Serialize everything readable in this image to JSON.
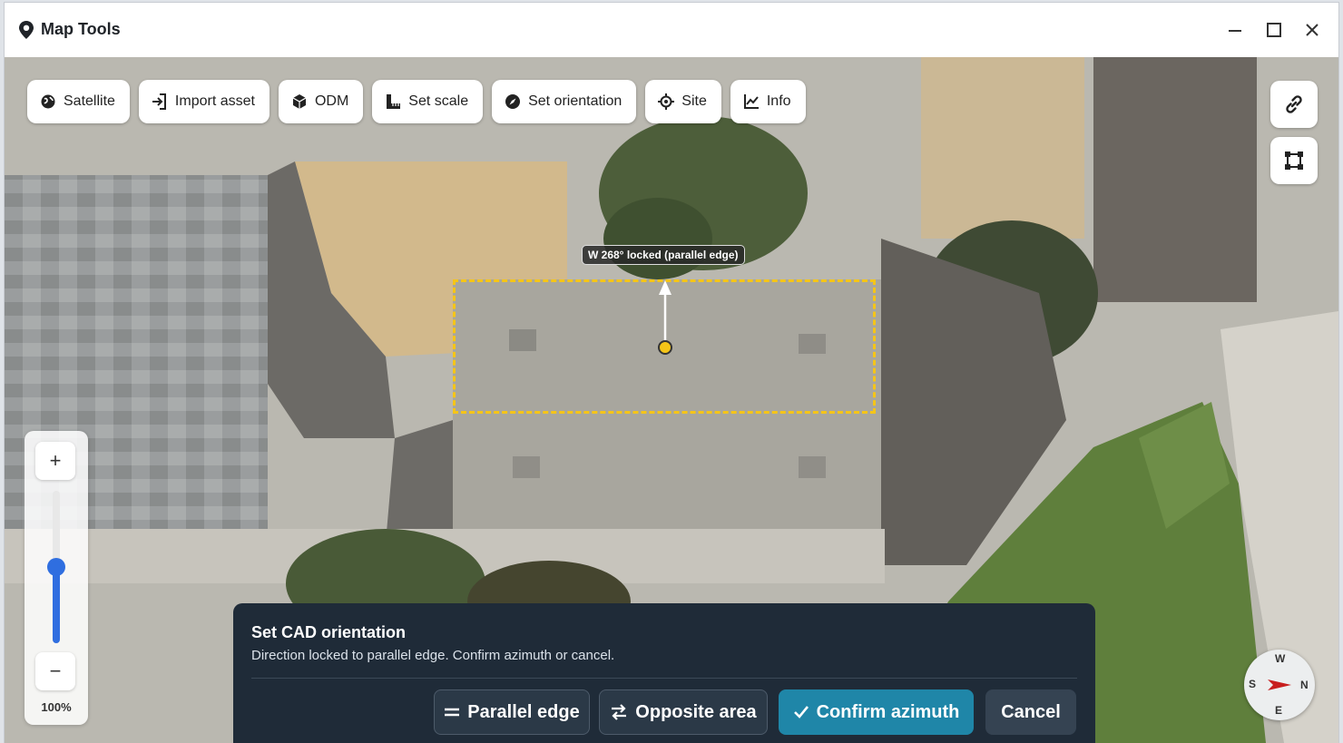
{
  "window": {
    "title": "Map Tools",
    "pin_icon": "map-pin-icon",
    "controls": [
      "minimize-icon",
      "maximize-icon",
      "close-icon"
    ]
  },
  "toolbar": {
    "buttons": [
      {
        "label": "Satellite",
        "icon": "globe-icon"
      },
      {
        "label": "Import asset",
        "icon": "import-icon"
      },
      {
        "label": "ODM",
        "icon": "cube-icon"
      },
      {
        "label": "Set scale",
        "icon": "ruler-icon"
      },
      {
        "label": "Set orientation",
        "icon": "compass-icon"
      },
      {
        "label": "Site",
        "icon": "crosshair-icon"
      },
      {
        "label": "Info",
        "icon": "chart-line-icon"
      }
    ]
  },
  "side_buttons": [
    {
      "icon": "link-icon"
    },
    {
      "icon": "polygon-icon"
    }
  ],
  "map": {
    "direction_label": "W 268° locked (parallel edge)"
  },
  "zoom": {
    "plus": "+",
    "minus": "−",
    "level_label": "100%",
    "level_fraction": 0.5
  },
  "panel": {
    "title": "Set CAD orientation",
    "description": "Direction locked to parallel edge. Confirm azimuth or cancel.",
    "buttons": {
      "parallel_edge": "Parallel edge",
      "opposite_area": "Opposite area",
      "confirm": "Confirm azimuth",
      "cancel": "Cancel"
    }
  },
  "compass": {
    "w": "W",
    "s": "S",
    "n": "N",
    "e": "E"
  },
  "colors": {
    "accent": "#1f86a8",
    "selection": "#f5c518",
    "panel": "#1f2b38",
    "zoom": "#2f6ee0"
  }
}
